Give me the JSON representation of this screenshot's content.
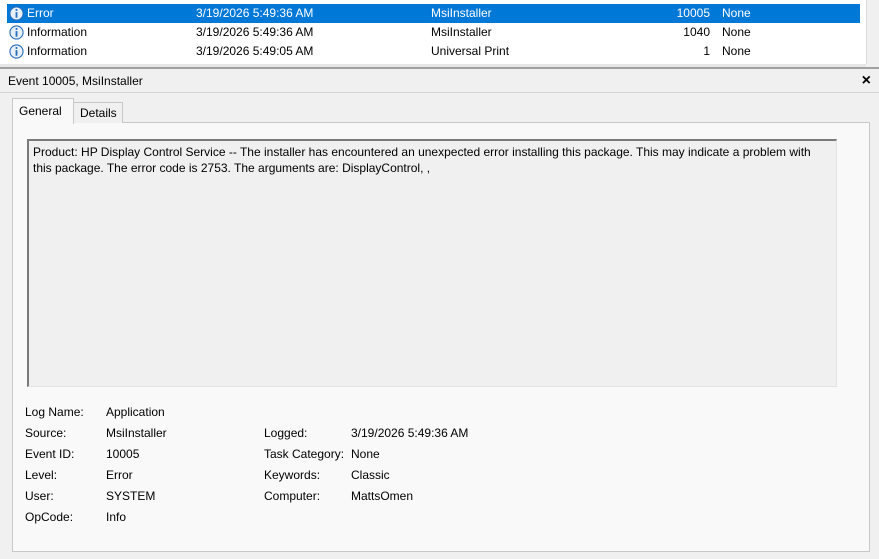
{
  "events": [
    {
      "level": "Error",
      "date": "3/19/2026 5:49:36 AM",
      "source": "MsiInstaller",
      "event_id": "10005",
      "task_category": "None",
      "selected": true
    },
    {
      "level": "Information",
      "date": "3/19/2026 5:49:36 AM",
      "source": "MsiInstaller",
      "event_id": "1040",
      "task_category": "None",
      "selected": false
    },
    {
      "level": "Information",
      "date": "3/19/2026 5:49:05 AM",
      "source": "Universal Print",
      "event_id": "1",
      "task_category": "None",
      "selected": false
    }
  ],
  "detail": {
    "title": "Event 10005, MsiInstaller",
    "close_glyph": "×",
    "tabs": [
      {
        "label": "General",
        "active": true
      },
      {
        "label": "Details",
        "active": false
      }
    ],
    "description": "Product: HP Display Control Service -- The installer has encountered an unexpected error installing this package. This may indicate a problem with this package. The error code is 2753. The arguments are: DisplayControl, ,",
    "properties": {
      "log_name": {
        "label": "Log Name:",
        "value": "Application"
      },
      "source": {
        "label": "Source:",
        "value": "MsiInstaller"
      },
      "logged": {
        "label": "Logged:",
        "value": "3/19/2026 5:49:36 AM"
      },
      "event_id": {
        "label": "Event ID:",
        "value": "10005"
      },
      "task_category": {
        "label": "Task Category:",
        "value": "None"
      },
      "level": {
        "label": "Level:",
        "value": "Error"
      },
      "keywords": {
        "label": "Keywords:",
        "value": "Classic"
      },
      "user": {
        "label": "User:",
        "value": "SYSTEM"
      },
      "computer": {
        "label": "Computer:",
        "value": "MattsOmen"
      },
      "opcode": {
        "label": "OpCode:",
        "value": "Info"
      }
    }
  },
  "icons": {
    "info": "info-circle-icon",
    "close": "close-icon"
  },
  "colors": {
    "selection": "#0078d7",
    "info_icon": "#2a6ebb"
  }
}
